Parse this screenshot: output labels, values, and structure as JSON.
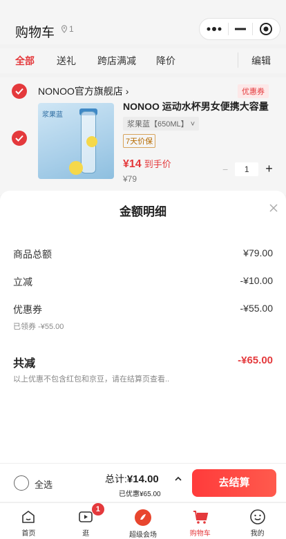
{
  "header": {
    "title": "购物车",
    "location_count": "1"
  },
  "tabs": [
    {
      "label": "全部",
      "active": true
    },
    {
      "label": "送礼",
      "active": false
    },
    {
      "label": "跨店满减",
      "active": false
    },
    {
      "label": "降价",
      "active": false
    }
  ],
  "edit_label": "编辑",
  "shop": {
    "name": "NONOO官方旗舰店",
    "coupon_tag": "优惠券",
    "product": {
      "image_brand": "浆果蓝",
      "title": "NONOO 运动水杯男女便携大容量",
      "spec": "浆果蓝【650ML】",
      "tag": "7天价保",
      "price_now": "¥14",
      "price_note": "到手价",
      "price_old": "¥79",
      "quantity": "1",
      "minus": "−",
      "plus": "+"
    }
  },
  "sheet": {
    "title": "金额明细",
    "rows": [
      {
        "label": "商品总额",
        "value": "¥79.00"
      },
      {
        "label": "立减",
        "value": "-¥10.00"
      },
      {
        "label": "优惠券",
        "value": "-¥55.00",
        "sub": "已领券 -¥55.00"
      }
    ],
    "total_label": "共减",
    "total_value": "-¥65.00",
    "note": "以上优惠不包含红包和京豆，请在结算页查看.."
  },
  "bottom_bar": {
    "select_all": "全选",
    "total_label": "总计:",
    "total_value": "¥14.00",
    "discount_note": "已优惠¥65.00",
    "checkout": "去结算"
  },
  "tabbar": [
    {
      "label": "首页",
      "icon": "home-icon",
      "active": false
    },
    {
      "label": "逛",
      "icon": "video-icon",
      "active": false,
      "badge": "1"
    },
    {
      "label": "超级会场",
      "icon": "venue-icon",
      "active": false
    },
    {
      "label": "购物车",
      "icon": "cart-icon",
      "active": true
    },
    {
      "label": "我的",
      "icon": "profile-icon",
      "active": false
    }
  ],
  "colors": {
    "accent": "#e4393c"
  }
}
